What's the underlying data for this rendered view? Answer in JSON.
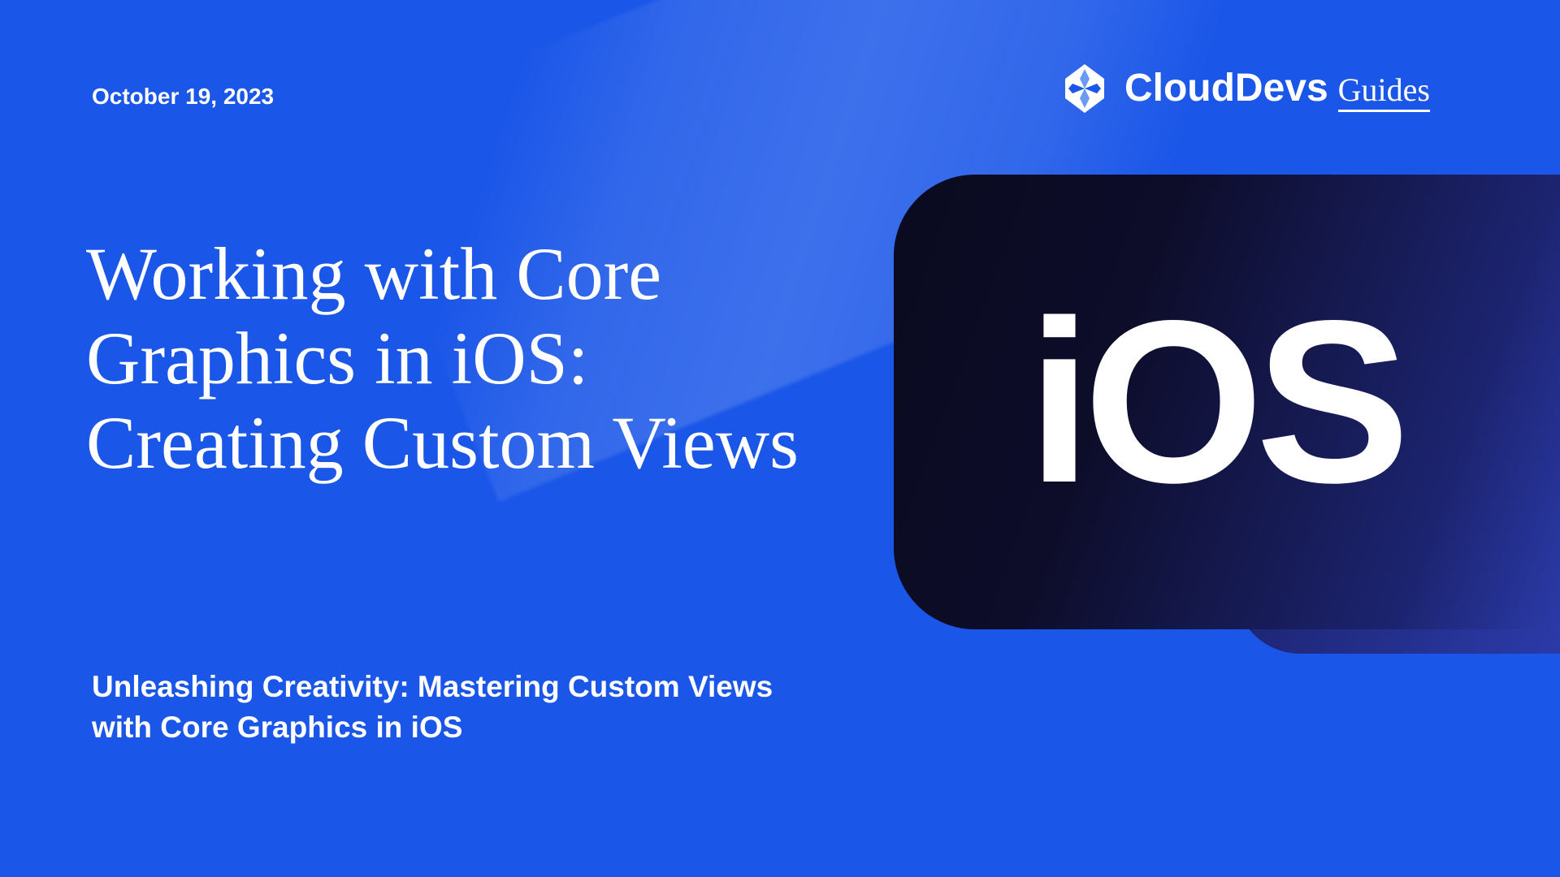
{
  "date": "October 19, 2023",
  "brand": {
    "main": "CloudDevs",
    "sub": "Guides"
  },
  "title": "Working with Core Graphics in iOS: Creating Custom Views",
  "subtitle": "Unleashing Creativity: Mastering Custom Views with Core Graphics in iOS",
  "badge_text": "iOS"
}
